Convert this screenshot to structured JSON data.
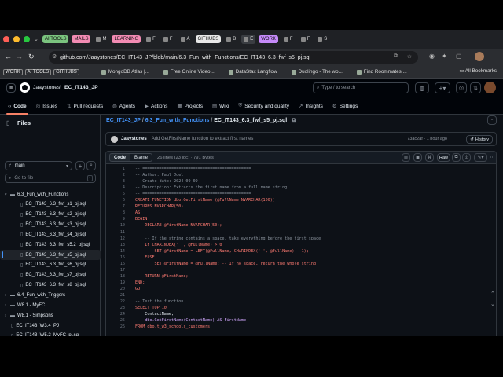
{
  "browser": {
    "tabs": [
      {
        "label": "AI TOOLS",
        "kind": "group",
        "color": "#7bc47f"
      },
      {
        "label": "MAILS",
        "kind": "group",
        "color": "#f28bb3"
      },
      {
        "label": "M",
        "kind": "tab"
      },
      {
        "label": "LEARNING",
        "kind": "group",
        "color": "#f28bb3"
      },
      {
        "label": "F",
        "kind": "tab"
      },
      {
        "label": "F",
        "kind": "tab"
      },
      {
        "label": "A",
        "kind": "tab"
      },
      {
        "label": "GITHUBS",
        "kind": "group",
        "color": "#e8e8e8"
      },
      {
        "label": "B",
        "kind": "tab"
      },
      {
        "label": "E",
        "kind": "tab",
        "active": true
      },
      {
        "label": "WORK",
        "kind": "group",
        "color": "#c58af9"
      },
      {
        "label": "F",
        "kind": "tab"
      },
      {
        "label": "F",
        "kind": "tab"
      },
      {
        "label": "S",
        "kind": "tab"
      }
    ],
    "url": "github.com/Jaaystones/EC_IT143_JP/blob/main/6.3_Fun_with_Functions/EC_IT143_6.3_fwf_s5_pj.sql",
    "bookmarks": {
      "tags": [
        "WORK",
        "AI TOOLS",
        "GITHUBS"
      ],
      "items": [
        "MongoDB Atlas |...",
        "Free Online Video...",
        "DataStax Langflow",
        "Duolingo - The wo...",
        "Find Roommates,..."
      ],
      "all_label": "All Bookmarks"
    }
  },
  "github": {
    "owner": "Jaaystones",
    "repo": "EC_IT143_JP",
    "search_placeholder": "Type / to search",
    "nav": [
      "Code",
      "Issues",
      "Pull requests",
      "Agents",
      "Actions",
      "Projects",
      "Wiki",
      "Security and quality",
      "Insights",
      "Settings"
    ]
  },
  "sidebar": {
    "title": "Files",
    "branch": "main",
    "filter_placeholder": "Go to file",
    "filter_kbd": "t",
    "items": [
      {
        "label": "6.3_Fun_with_Functions",
        "type": "folder",
        "open": true,
        "indent": 0
      },
      {
        "label": "EC_IT143_6.3_fwf_s1_pj.sql",
        "type": "file",
        "indent": 1
      },
      {
        "label": "EC_IT143_6.3_fwf_s2_pj.sql",
        "type": "file",
        "indent": 1
      },
      {
        "label": "EC_IT143_6.3_fwf_s3_pj.sql",
        "type": "file",
        "indent": 1
      },
      {
        "label": "EC_IT143_6.3_fwf_s4_pj.sql",
        "type": "file",
        "indent": 1
      },
      {
        "label": "EC_IT143_6.3_fwf_s5.2_pj.sql",
        "type": "file",
        "indent": 1
      },
      {
        "label": "EC_IT143_6.3_fwf_s5_pj.sql",
        "type": "file",
        "indent": 1,
        "selected": true
      },
      {
        "label": "EC_IT143_6.3_fwf_s6_pj.sql",
        "type": "file",
        "indent": 1
      },
      {
        "label": "EC_IT143_6.3_fwf_s7_pj.sql",
        "type": "file",
        "indent": 1
      },
      {
        "label": "EC_IT143_6.3_fwf_s8_pj.sql",
        "type": "file",
        "indent": 1
      },
      {
        "label": "6.4_Fun_with_Triggers",
        "type": "folder",
        "open": false,
        "indent": 0
      },
      {
        "label": "W8.1 - MyFC",
        "type": "folder",
        "open": false,
        "indent": 0
      },
      {
        "label": "W8.1 - Simpsons",
        "type": "folder",
        "open": false,
        "indent": 0
      },
      {
        "label": "EC_IT143_W3.4_PJ",
        "type": "file",
        "indent": 0
      },
      {
        "label": "EC_IT143_W5.2_MyFC_pj.sql",
        "type": "file",
        "indent": 0
      },
      {
        "label": "EC_IT143_W5.2_Simpsons_pj.sql",
        "type": "file",
        "indent": 0
      },
      {
        "label": "README.md",
        "type": "file",
        "indent": 0
      },
      {
        "label": "Test123.txt",
        "type": "file",
        "indent": 0
      }
    ]
  },
  "breadcrumb": {
    "repo": "EC_IT143_JP",
    "folder": "6.3_Fun_with_Functions",
    "file": "EC_IT143_6.3_fwf_s5_pj.sql"
  },
  "commit": {
    "author": "Jaaystones",
    "message": "Add GetFirstName function to extract first names",
    "meta": "73ac2af · 1 hour ago",
    "history_label": "History"
  },
  "file_view": {
    "tab_code": "Code",
    "tab_blame": "Blame",
    "info": "26 lines (23 loc) · 791 Bytes",
    "raw_label": "Raw"
  },
  "code_lines": [
    {
      "n": "1",
      "t": "-- =============================================",
      "c": "#8b949e"
    },
    {
      "n": "2",
      "t": "-- Author: Paul Joel",
      "c": "#8b949e"
    },
    {
      "n": "3",
      "t": "-- Create date: 2024-09-09",
      "c": "#8b949e"
    },
    {
      "n": "4",
      "t": "-- Description: Extracts the first name from a full name string.",
      "c": "#8b949e"
    },
    {
      "n": "5",
      "t": "-- =============================================",
      "c": "#8b949e"
    },
    {
      "n": "6",
      "t": "CREATE FUNCTION dbo.GetFirstName (@FullName NVARCHAR(100))",
      "c": "#ff7b72"
    },
    {
      "n": "7",
      "t": "RETURNS NVARCHAR(50)",
      "c": "#ff7b72"
    },
    {
      "n": "8",
      "t": "AS",
      "c": "#ff7b72"
    },
    {
      "n": "9",
      "t": "BEGIN",
      "c": "#ff7b72"
    },
    {
      "n": "10",
      "t": "    DECLARE @FirstName NVARCHAR(50);",
      "c": "#ff7b72"
    },
    {
      "n": "11",
      "t": "",
      "c": "#e6edf3"
    },
    {
      "n": "12",
      "t": "    -- If the string contains a space, take everything before the first space",
      "c": "#8b949e"
    },
    {
      "n": "13",
      "t": "    IF CHARINDEX(' ', @FullName) > 0",
      "c": "#ff7b72"
    },
    {
      "n": "14",
      "t": "        SET @FirstName = LEFT(@FullName, CHARINDEX(' ', @FullName) - 1);",
      "c": "#ff7b72"
    },
    {
      "n": "15",
      "t": "    ELSE",
      "c": "#ff7b72"
    },
    {
      "n": "16",
      "t": "        SET @FirstName = @FullName; -- If no space, return the whole string",
      "c": "#ff7b72"
    },
    {
      "n": "17",
      "t": "",
      "c": "#e6edf3"
    },
    {
      "n": "18",
      "t": "    RETURN @FirstName;",
      "c": "#ff7b72"
    },
    {
      "n": "19",
      "t": "END;",
      "c": "#ff7b72"
    },
    {
      "n": "20",
      "t": "GO",
      "c": "#ff7b72"
    },
    {
      "n": "21",
      "t": "",
      "c": "#e6edf3"
    },
    {
      "n": "22",
      "t": "-- Test the function",
      "c": "#8b949e"
    },
    {
      "n": "23",
      "t": "SELECT TOP 10",
      "c": "#ff7b72"
    },
    {
      "n": "24",
      "t": "    ContactName,",
      "c": "#e6edf3"
    },
    {
      "n": "25",
      "t": "    dbo.GetFirstName(ContactName) AS FirstName",
      "c": "#d2a8ff"
    },
    {
      "n": "26",
      "t": "FROM dbo.t_w3_schools_customers;",
      "c": "#ff7b72"
    }
  ],
  "colors": {
    "accent": "#4493f8",
    "underline": "#f78166",
    "bg": "#0d1117"
  }
}
